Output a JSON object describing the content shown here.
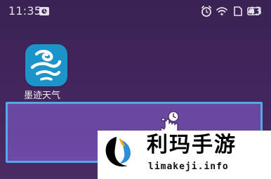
{
  "status_bar": {
    "time": "11:35",
    "battery_level": "43",
    "icons": [
      "notification-icon",
      "alarm-icon",
      "wifi-icon",
      "sim-icon",
      "battery-icon"
    ]
  },
  "apps": [
    {
      "name": "墨迹天气",
      "icon": "moji-weather-icon",
      "colors": {
        "background": "#1c93c9",
        "swirl": "#ffffff"
      }
    }
  ],
  "dock": {
    "highlight_color": "#58a7ea",
    "background_color": "#6b49a0",
    "gesture_icon": "touch-clock-gesture-icon"
  },
  "watermark": {
    "title": "利玛手游",
    "domain": "limakeji.info"
  },
  "colors": {
    "wallpaper": "#40245b",
    "status_text": "#e5e1ea",
    "watermark_bg": "#ffffff"
  }
}
